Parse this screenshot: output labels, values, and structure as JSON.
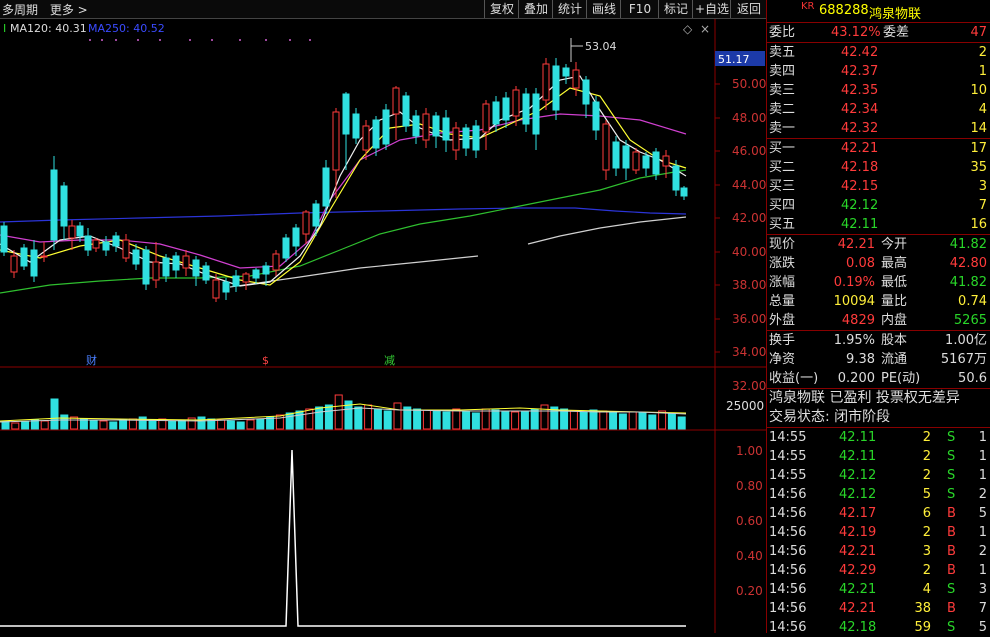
{
  "toolbar": {
    "left_items": [
      "多周期",
      "更多 >"
    ],
    "buttons": [
      "复权",
      "叠加",
      "统计",
      "画线",
      "F10",
      "标记",
      "+自选",
      "返回"
    ]
  },
  "ma_legend": {
    "ma120": "MA120: 40.31",
    "ma250": "MA250: 40.52"
  },
  "main_chart": {
    "price_ticks": [
      "50.00",
      "48.00",
      "46.00",
      "44.00",
      "42.00",
      "40.00",
      "38.00",
      "36.00",
      "34.00",
      "32.00"
    ],
    "current_price_tag": "51.17",
    "high_label": "53.04",
    "event_markers": [
      "财",
      "$",
      "减"
    ]
  },
  "volume_chart": {
    "tick": "25000"
  },
  "indicator_chart": {
    "ticks": [
      "1.00",
      "0.80",
      "0.60",
      "0.40",
      "0.20"
    ]
  },
  "quote": {
    "kr": "KR",
    "code": "688288",
    "name": "鸿泉物联",
    "weibi_label": "委比",
    "weibi_value": "43.12%",
    "weicha_label": "委差",
    "weicha_value": "47",
    "sell": [
      {
        "label": "卖五",
        "price": "42.42",
        "vol": "2"
      },
      {
        "label": "卖四",
        "price": "42.37",
        "vol": "1"
      },
      {
        "label": "卖三",
        "price": "42.35",
        "vol": "10"
      },
      {
        "label": "卖二",
        "price": "42.34",
        "vol": "4"
      },
      {
        "label": "卖一",
        "price": "42.32",
        "vol": "14"
      }
    ],
    "buy": [
      {
        "label": "买一",
        "price": "42.21",
        "vol": "17"
      },
      {
        "label": "买二",
        "price": "42.18",
        "vol": "35"
      },
      {
        "label": "买三",
        "price": "42.15",
        "vol": "3"
      },
      {
        "label": "买四",
        "price": "42.12",
        "vol": "7"
      },
      {
        "label": "买五",
        "price": "42.11",
        "vol": "16"
      }
    ],
    "stats1": [
      {
        "l1": "现价",
        "v1": "42.21",
        "l2": "今开",
        "v2": "41.82"
      },
      {
        "l1": "涨跌",
        "v1": "0.08",
        "l2": "最高",
        "v2": "42.80"
      },
      {
        "l1": "涨幅",
        "v1": "0.19%",
        "l2": "最低",
        "v2": "41.82"
      },
      {
        "l1": "总量",
        "v1": "10094",
        "l2": "量比",
        "v2": "0.74"
      },
      {
        "l1": "外盘",
        "v1": "4829",
        "l2": "内盘",
        "v2": "5265"
      }
    ],
    "stats2": [
      {
        "l1": "换手",
        "v1": "1.95%",
        "l2": "股本",
        "v2": "1.00亿"
      },
      {
        "l1": "净资",
        "v1": "9.38",
        "l2": "流通",
        "v2": "5167万"
      },
      {
        "l1": "收益(一)",
        "v1": "0.200",
        "l2": "PE(动)",
        "v2": "50.6"
      }
    ],
    "info_line1": "鸿泉物联 已盈利 投票权无差异",
    "info_line2": "交易状态: 闭市阶段",
    "ticks": [
      {
        "t": "14:55",
        "p": "42.11",
        "v": "2",
        "s": "S",
        "n": "1"
      },
      {
        "t": "14:55",
        "p": "42.11",
        "v": "2",
        "s": "S",
        "n": "1"
      },
      {
        "t": "14:55",
        "p": "42.12",
        "v": "2",
        "s": "S",
        "n": "1"
      },
      {
        "t": "14:56",
        "p": "42.12",
        "v": "5",
        "s": "S",
        "n": "2"
      },
      {
        "t": "14:56",
        "p": "42.17",
        "v": "6",
        "s": "B",
        "n": "5"
      },
      {
        "t": "14:56",
        "p": "42.19",
        "v": "2",
        "s": "B",
        "n": "1"
      },
      {
        "t": "14:56",
        "p": "42.21",
        "v": "3",
        "s": "B",
        "n": "2"
      },
      {
        "t": "14:56",
        "p": "42.29",
        "v": "2",
        "s": "B",
        "n": "1"
      },
      {
        "t": "14:56",
        "p": "42.21",
        "v": "4",
        "s": "S",
        "n": "3"
      },
      {
        "t": "14:56",
        "p": "42.21",
        "v": "38",
        "s": "B",
        "n": "7"
      },
      {
        "t": "14:56",
        "p": "42.18",
        "v": "59",
        "s": "S",
        "n": "5"
      }
    ]
  }
}
